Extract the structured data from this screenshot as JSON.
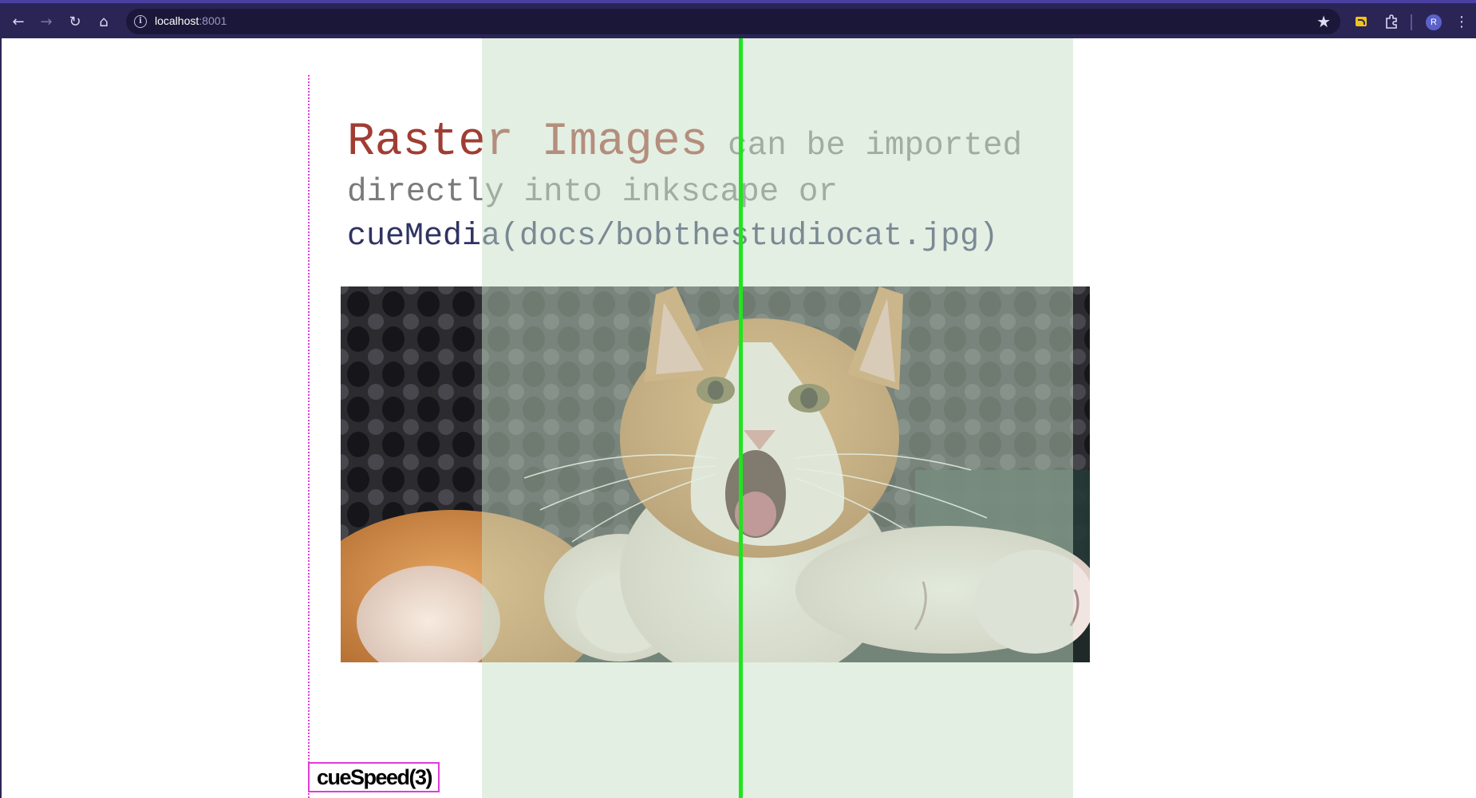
{
  "browser": {
    "url_host": "localhost",
    "url_port": ":8001",
    "profile_initial": "R",
    "icons": {
      "back": "back-arrow-icon",
      "forward": "forward-arrow-icon",
      "reload": "reload-icon",
      "home": "home-icon",
      "site_info": "info-icon",
      "bookmark": "star-icon",
      "extension": "rss-extension-icon",
      "extensions_menu": "puzzle-icon",
      "menu": "kebab-menu-icon"
    }
  },
  "slide": {
    "headline_big": "Raster Images",
    "headline_rest_line1": " can be imported",
    "headline_line2": "directly into inkscape or",
    "code_line": "cueMedia(docs/bobthestudiocat.jpg)",
    "cue_label": "cueSpeed(3)",
    "image_subject": "bob-the-studio-cat-photo",
    "colors": {
      "headline_accent": "#a03d33",
      "headline_text": "#7a7a7a",
      "code_text": "#2f3361",
      "playhead": "#1ee51e",
      "guide": "#e23bd8",
      "safe_zone": "#c8e0c8"
    }
  }
}
